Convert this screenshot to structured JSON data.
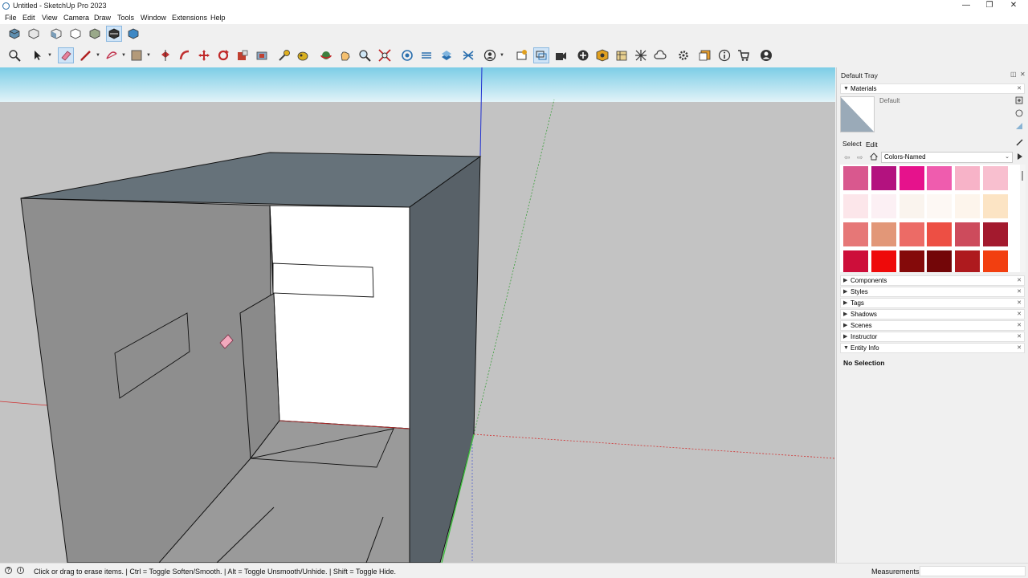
{
  "window": {
    "title": "Untitled - SketchUp Pro 2023",
    "minimize": "—",
    "maximize": "❐",
    "close": "✕"
  },
  "menu": [
    "File",
    "Edit",
    "View",
    "Camera",
    "Draw",
    "Tools",
    "Window",
    "Extensions",
    "Help"
  ],
  "tray": {
    "title": "Default Tray",
    "materials": {
      "header": "Materials",
      "current_material": "Default",
      "tabs": [
        "Select",
        "Edit"
      ],
      "library": "Colors-Named",
      "swatch_colors": [
        "#d9588e",
        "#b3127f",
        "#e6128c",
        "#ef5cae",
        "#f7b3c8",
        "#f8bfcf",
        "#fce6ea",
        "#fcf0f4",
        "#faf4ee",
        "#fdf8f4",
        "#fdf5ec",
        "#fce4c4",
        "#e67777",
        "#e29778",
        "#ec6b66",
        "#ed4f44",
        "#cd4b5c",
        "#a31a2e",
        "#cd0e3a",
        "#ee0a0a",
        "#840a0a",
        "#730608",
        "#ae1a1e",
        "#f23f10"
      ]
    },
    "sections": [
      "Components",
      "Styles",
      "Tags",
      "Shadows",
      "Scenes",
      "Instructor"
    ],
    "entity_info": {
      "header": "Entity Info",
      "selection": "No Selection"
    }
  },
  "status": {
    "hint": "Click or drag to erase items. | Ctrl = Toggle Soften/Smooth. | Alt = Toggle Unsmooth/Unhide. | Shift = Toggle Hide.",
    "measurements_label": "Measurements"
  },
  "colors": {
    "sky": "#7fd0e8",
    "ground": "#c2c2c2",
    "box_top": "#66727a",
    "box_left": "#8e8e8e",
    "box_right": "#586168",
    "accent_active": "#cfe4f7"
  }
}
